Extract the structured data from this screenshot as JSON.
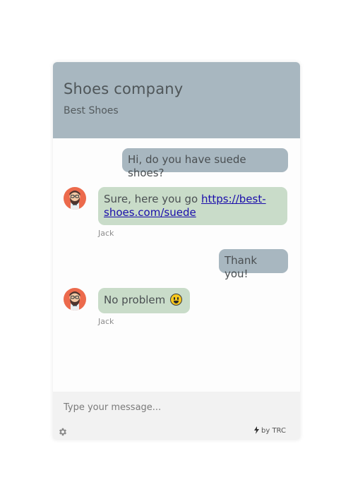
{
  "header": {
    "title": "Shoes company",
    "subtitle": "Best Shoes"
  },
  "messages": [
    {
      "direction": "outgoing",
      "text": "Hi, do you have suede shoes?"
    },
    {
      "direction": "incoming",
      "text": "Sure, here you go ",
      "link_text": "https://best-shoes.com/suede",
      "sender": "Jack",
      "avatar": "bearded-man-avatar"
    },
    {
      "direction": "outgoing",
      "text": "Thank you!"
    },
    {
      "direction": "incoming",
      "text": "No problem ",
      "emoji": "grinning-face-emoji",
      "sender": "Jack",
      "avatar": "bearded-man-avatar"
    }
  ],
  "composer": {
    "placeholder": "Type your message..."
  },
  "footer": {
    "settings_icon": "gear-icon",
    "branding": "by TRC",
    "branding_icon": "lightning-bolt-icon"
  },
  "colors": {
    "header_bg": "#a8b7c0",
    "outgoing_bubble": "#a8b7c0",
    "incoming_bubble": "#c9dcc9",
    "avatar_bg": "#ec6a4c",
    "footer_bg": "#f2f2f2"
  }
}
